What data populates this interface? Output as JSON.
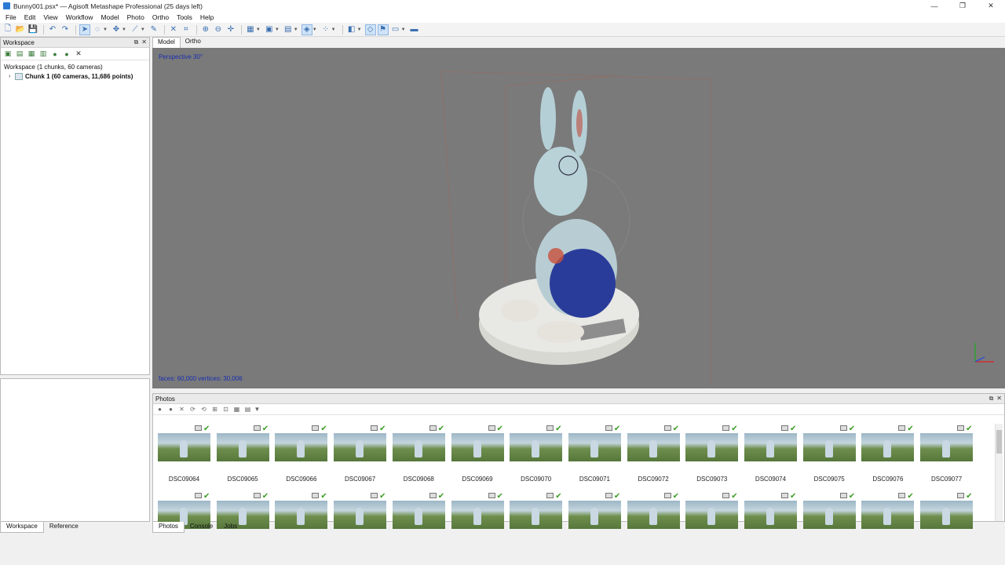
{
  "window": {
    "title": "Bunny001.psx* — Agisoft Metashape Professional (25 days left)"
  },
  "menu": [
    "File",
    "Edit",
    "View",
    "Workflow",
    "Model",
    "Photo",
    "Ortho",
    "Tools",
    "Help"
  ],
  "workspace": {
    "header": "Workspace",
    "root": "Workspace (1 chunks, 60 cameras)",
    "chunk": "Chunk 1 (60 cameras, 11,686 points)"
  },
  "left_tabs": {
    "workspace": "Workspace",
    "reference": "Reference"
  },
  "view_tabs": {
    "model": "Model",
    "ortho": "Ortho"
  },
  "viewport": {
    "projection": "Perspective 30°",
    "stats": "faces: 60,000 vertices: 30,006"
  },
  "photos": {
    "header": "Photos",
    "row1": [
      "DSC09064",
      "DSC09065",
      "DSC09066",
      "DSC09067",
      "DSC09068",
      "DSC09069",
      "DSC09070",
      "DSC09071",
      "DSC09072",
      "DSC09073",
      "DSC09074",
      "DSC09075",
      "DSC09076",
      "DSC09077"
    ]
  },
  "bottom_tabs": {
    "photos": "Photos",
    "console": "Console",
    "jobs": "Jobs"
  },
  "colors": {
    "viewport_bg": "#7a7a7a",
    "accent": "#2b7bd4",
    "check": "#3a9d23"
  }
}
